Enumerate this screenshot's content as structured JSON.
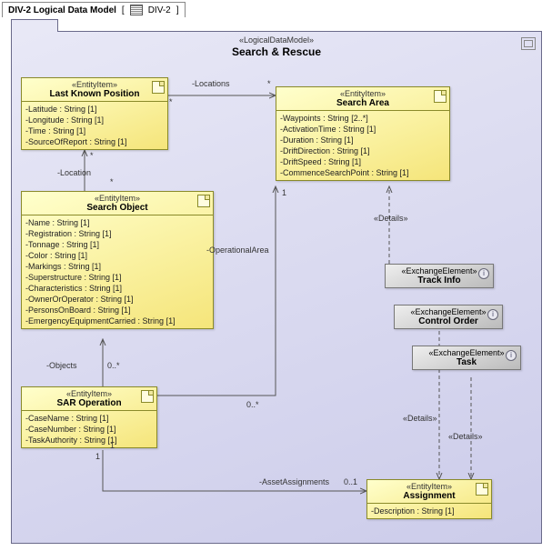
{
  "header": {
    "title": "DIV-2 Logical Data Model",
    "tabLabel": "DIV-2"
  },
  "package": {
    "stereo": "«LogicalDataModel»",
    "title": "Search & Rescue"
  },
  "entities": {
    "lkp": {
      "stereo": "«EntityItem»",
      "name": "Last Known Position",
      "attrs": [
        "-Latitude : String [1]",
        "-Longitude : String [1]",
        "-Time : String [1]",
        "-SourceOfReport : String [1]"
      ]
    },
    "sa": {
      "stereo": "«EntityItem»",
      "name": "Search Area",
      "attrs": [
        "-Waypoints : String [2..*]",
        "-ActivationTime : String [1]",
        "-Duration : String [1]",
        "-DriftDirection : String [1]",
        "-DriftSpeed : String [1]",
        "-CommenceSearchPoint : String [1]"
      ]
    },
    "so": {
      "stereo": "«EntityItem»",
      "name": "Search Object",
      "attrs": [
        "-Name : String [1]",
        "-Registration : String [1]",
        "-Tonnage : String [1]",
        "-Color : String [1]",
        "-Markings : String [1]",
        "-Superstructure : String [1]",
        "-Characteristics : String [1]",
        "-OwnerOrOperator : String [1]",
        "-PersonsOnBoard : String [1]",
        "-EmergencyEquipmentCarried : String [1]"
      ]
    },
    "sar": {
      "stereo": "«EntityItem»",
      "name": "SAR Operation",
      "attrs": [
        "-CaseName : String [1]",
        "-CaseNumber : String [1]",
        "-TaskAuthority : String [1]"
      ]
    },
    "asgn": {
      "stereo": "«EntityItem»",
      "name": "Assignment",
      "attrs": [
        "-Description : String [1]"
      ]
    }
  },
  "exchanges": {
    "track": {
      "stereo": "«ExchangeElement»",
      "name": "Track Info"
    },
    "ctrl": {
      "stereo": "«ExchangeElement»",
      "name": "Control Order"
    },
    "task": {
      "stereo": "«ExchangeElement»",
      "name": "Task"
    }
  },
  "labels": {
    "locations": "-Locations",
    "location": "-Location",
    "operationalArea": "-OperationalArea",
    "objects": "-Objects",
    "assetAssignments": "-AssetAssignments",
    "details": "«Details»",
    "star": "*",
    "one": "1",
    "zeroStar": "0..*",
    "zeroOne": "0..1"
  }
}
